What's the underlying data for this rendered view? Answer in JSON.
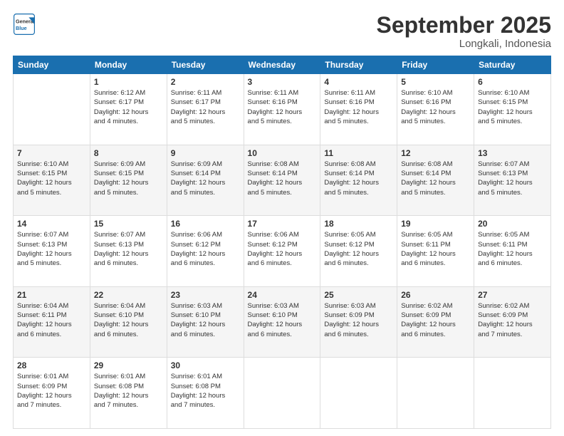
{
  "logo": {
    "line1": "General",
    "line2": "Blue"
  },
  "title": "September 2025",
  "subtitle": "Longkali, Indonesia",
  "weekdays": [
    "Sunday",
    "Monday",
    "Tuesday",
    "Wednesday",
    "Thursday",
    "Friday",
    "Saturday"
  ],
  "weeks": [
    [
      {
        "day": "",
        "info": ""
      },
      {
        "day": "1",
        "info": "Sunrise: 6:12 AM\nSunset: 6:17 PM\nDaylight: 12 hours\nand 4 minutes."
      },
      {
        "day": "2",
        "info": "Sunrise: 6:11 AM\nSunset: 6:17 PM\nDaylight: 12 hours\nand 5 minutes."
      },
      {
        "day": "3",
        "info": "Sunrise: 6:11 AM\nSunset: 6:16 PM\nDaylight: 12 hours\nand 5 minutes."
      },
      {
        "day": "4",
        "info": "Sunrise: 6:11 AM\nSunset: 6:16 PM\nDaylight: 12 hours\nand 5 minutes."
      },
      {
        "day": "5",
        "info": "Sunrise: 6:10 AM\nSunset: 6:16 PM\nDaylight: 12 hours\nand 5 minutes."
      },
      {
        "day": "6",
        "info": "Sunrise: 6:10 AM\nSunset: 6:15 PM\nDaylight: 12 hours\nand 5 minutes."
      }
    ],
    [
      {
        "day": "7",
        "info": "Sunrise: 6:10 AM\nSunset: 6:15 PM\nDaylight: 12 hours\nand 5 minutes."
      },
      {
        "day": "8",
        "info": "Sunrise: 6:09 AM\nSunset: 6:15 PM\nDaylight: 12 hours\nand 5 minutes."
      },
      {
        "day": "9",
        "info": "Sunrise: 6:09 AM\nSunset: 6:14 PM\nDaylight: 12 hours\nand 5 minutes."
      },
      {
        "day": "10",
        "info": "Sunrise: 6:08 AM\nSunset: 6:14 PM\nDaylight: 12 hours\nand 5 minutes."
      },
      {
        "day": "11",
        "info": "Sunrise: 6:08 AM\nSunset: 6:14 PM\nDaylight: 12 hours\nand 5 minutes."
      },
      {
        "day": "12",
        "info": "Sunrise: 6:08 AM\nSunset: 6:14 PM\nDaylight: 12 hours\nand 5 minutes."
      },
      {
        "day": "13",
        "info": "Sunrise: 6:07 AM\nSunset: 6:13 PM\nDaylight: 12 hours\nand 5 minutes."
      }
    ],
    [
      {
        "day": "14",
        "info": "Sunrise: 6:07 AM\nSunset: 6:13 PM\nDaylight: 12 hours\nand 5 minutes."
      },
      {
        "day": "15",
        "info": "Sunrise: 6:07 AM\nSunset: 6:13 PM\nDaylight: 12 hours\nand 6 minutes."
      },
      {
        "day": "16",
        "info": "Sunrise: 6:06 AM\nSunset: 6:12 PM\nDaylight: 12 hours\nand 6 minutes."
      },
      {
        "day": "17",
        "info": "Sunrise: 6:06 AM\nSunset: 6:12 PM\nDaylight: 12 hours\nand 6 minutes."
      },
      {
        "day": "18",
        "info": "Sunrise: 6:05 AM\nSunset: 6:12 PM\nDaylight: 12 hours\nand 6 minutes."
      },
      {
        "day": "19",
        "info": "Sunrise: 6:05 AM\nSunset: 6:11 PM\nDaylight: 12 hours\nand 6 minutes."
      },
      {
        "day": "20",
        "info": "Sunrise: 6:05 AM\nSunset: 6:11 PM\nDaylight: 12 hours\nand 6 minutes."
      }
    ],
    [
      {
        "day": "21",
        "info": "Sunrise: 6:04 AM\nSunset: 6:11 PM\nDaylight: 12 hours\nand 6 minutes."
      },
      {
        "day": "22",
        "info": "Sunrise: 6:04 AM\nSunset: 6:10 PM\nDaylight: 12 hours\nand 6 minutes."
      },
      {
        "day": "23",
        "info": "Sunrise: 6:03 AM\nSunset: 6:10 PM\nDaylight: 12 hours\nand 6 minutes."
      },
      {
        "day": "24",
        "info": "Sunrise: 6:03 AM\nSunset: 6:10 PM\nDaylight: 12 hours\nand 6 minutes."
      },
      {
        "day": "25",
        "info": "Sunrise: 6:03 AM\nSunset: 6:09 PM\nDaylight: 12 hours\nand 6 minutes."
      },
      {
        "day": "26",
        "info": "Sunrise: 6:02 AM\nSunset: 6:09 PM\nDaylight: 12 hours\nand 6 minutes."
      },
      {
        "day": "27",
        "info": "Sunrise: 6:02 AM\nSunset: 6:09 PM\nDaylight: 12 hours\nand 7 minutes."
      }
    ],
    [
      {
        "day": "28",
        "info": "Sunrise: 6:01 AM\nSunset: 6:09 PM\nDaylight: 12 hours\nand 7 minutes."
      },
      {
        "day": "29",
        "info": "Sunrise: 6:01 AM\nSunset: 6:08 PM\nDaylight: 12 hours\nand 7 minutes."
      },
      {
        "day": "30",
        "info": "Sunrise: 6:01 AM\nSunset: 6:08 PM\nDaylight: 12 hours\nand 7 minutes."
      },
      {
        "day": "",
        "info": ""
      },
      {
        "day": "",
        "info": ""
      },
      {
        "day": "",
        "info": ""
      },
      {
        "day": "",
        "info": ""
      }
    ]
  ]
}
